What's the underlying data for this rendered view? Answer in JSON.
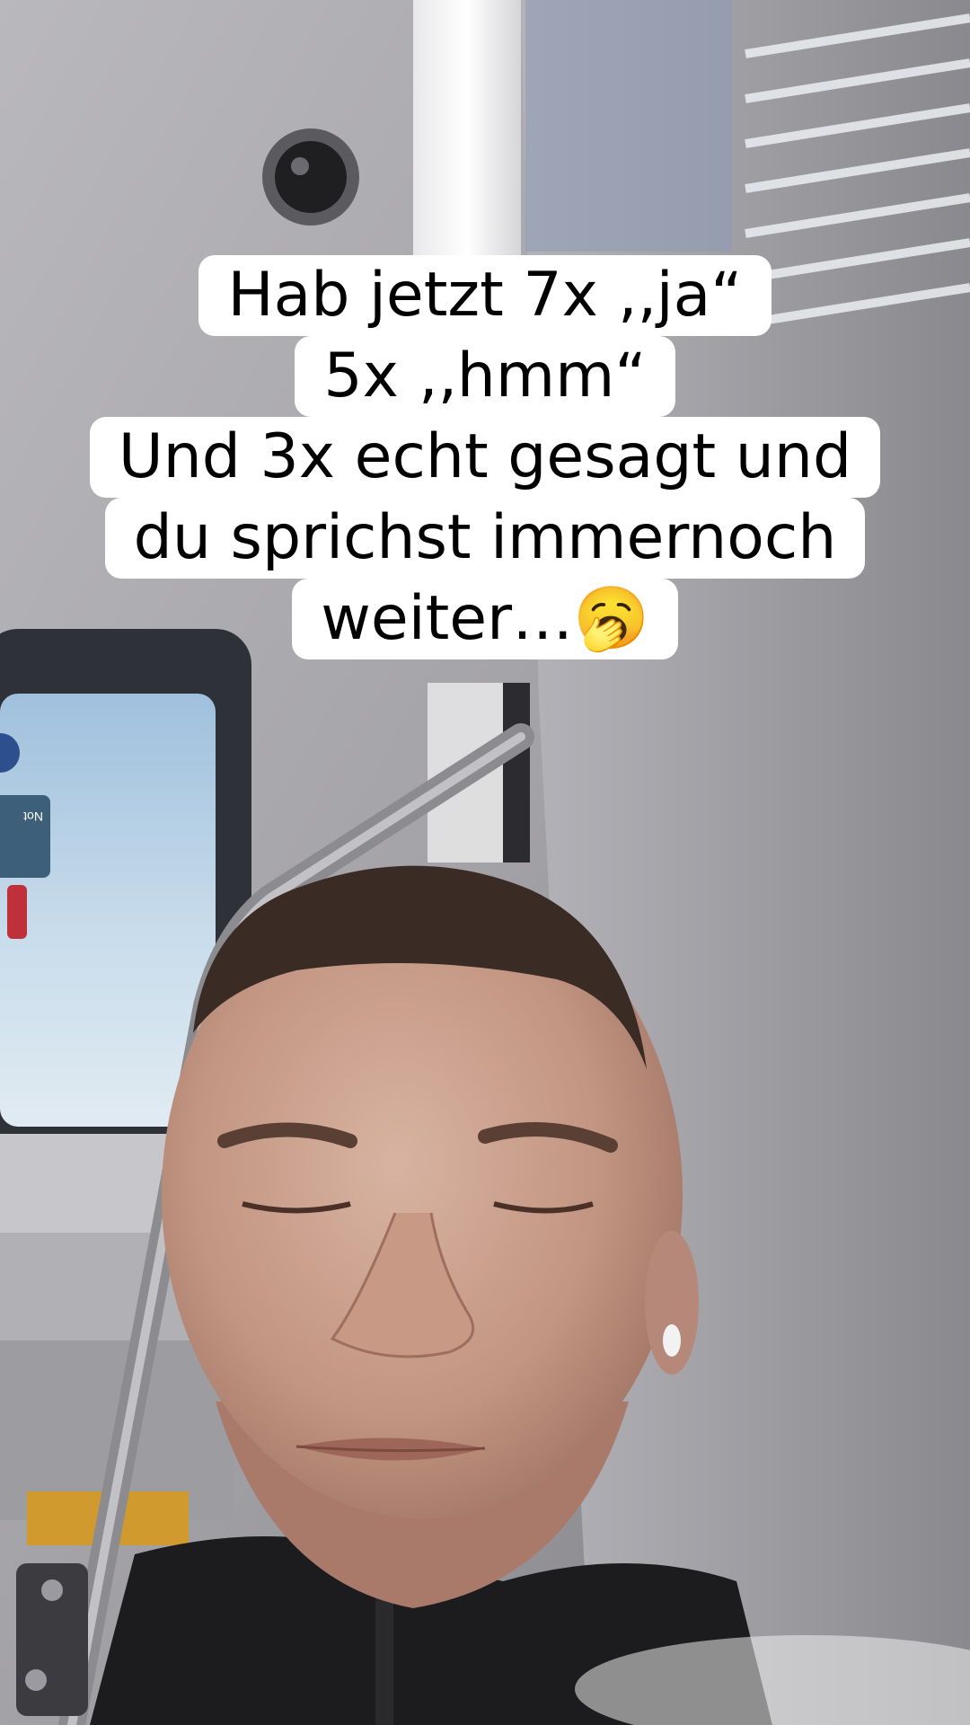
{
  "caption": {
    "lines": [
      "Hab jetzt 7x ‚‚ja“",
      "5x ‚‚hmm“",
      "Und 3x echt gesagt und",
      "du sprichst immernoch",
      "weiter…🥱"
    ]
  },
  "sign": {
    "label": "Not"
  },
  "colors": {
    "ceiling": "#a9a8ab",
    "window_sky": "#b7cfe3",
    "skin": "#c59a87",
    "hair": "#3a2c24",
    "jacket": "#1c1c1e",
    "caption_bg": "#ffffff",
    "caption_text": "#000000"
  }
}
